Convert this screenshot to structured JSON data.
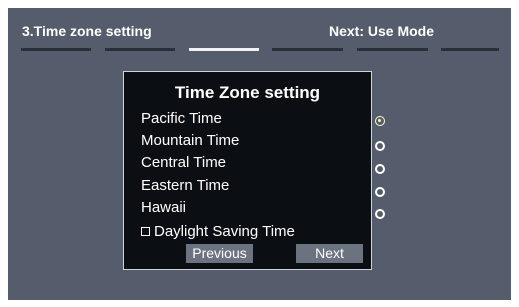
{
  "header": {
    "step_title": "3.Time zone setting",
    "next_step": "Next: Use Mode",
    "progress": {
      "total_steps": 6,
      "current_step": 3
    }
  },
  "dialog": {
    "title": "Time Zone setting",
    "time_zones": [
      {
        "label": "Pacific Time",
        "selected": true
      },
      {
        "label": "Mountain Time",
        "selected": false
      },
      {
        "label": "Central Time",
        "selected": false
      },
      {
        "label": "Eastern Time",
        "selected": false
      },
      {
        "label": "Hawaii",
        "selected": false
      }
    ],
    "daylight_saving": {
      "label": "Daylight Saving Time",
      "checked": false
    },
    "buttons": {
      "previous": "Previous",
      "next": "Next"
    }
  },
  "colors": {
    "screen_bg": "#555d6d",
    "dialog_bg": "#0b0f14",
    "button_bg": "#6b7280",
    "progress_active": "#f2f2f2",
    "progress_inactive": "#2a2f39"
  }
}
